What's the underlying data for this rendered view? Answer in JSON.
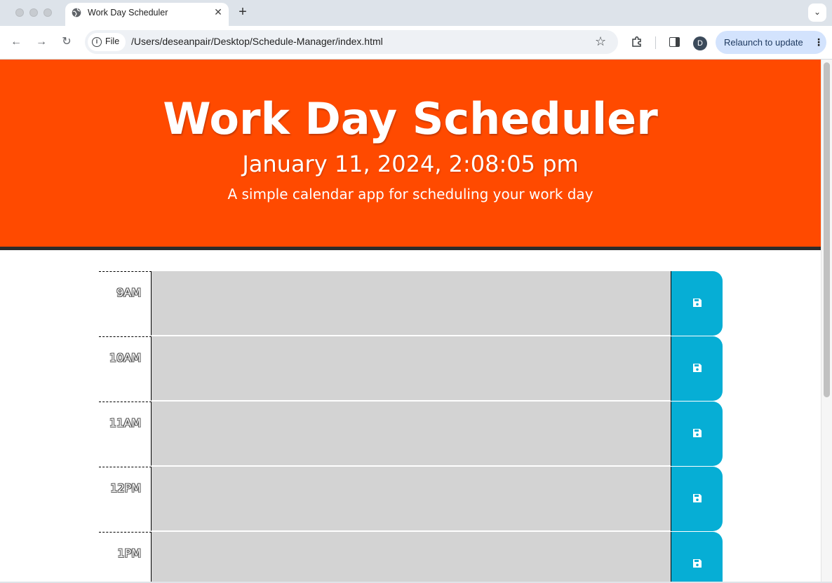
{
  "browser": {
    "tab_title": "Work Day Scheduler",
    "close_glyph": "✕",
    "new_tab_glyph": "+",
    "tab_menu_glyph": "⌄",
    "file_chip_label": "File",
    "url": "/Users/deseanpair/Desktop/Schedule-Manager/index.html",
    "avatar_letter": "D",
    "relaunch_label": "Relaunch to update",
    "kebab_glyph": "⋮",
    "back_glyph": "←",
    "forward_glyph": "→",
    "reload_glyph": "↻",
    "star_glyph": "☆",
    "info_glyph": "i"
  },
  "header": {
    "title": "Work Day Scheduler",
    "datetime": "January 11, 2024, 2:08:05 pm",
    "lead": "A simple calendar app for scheduling your work day"
  },
  "schedule": {
    "rows": [
      {
        "hour": "9AM"
      },
      {
        "hour": "10AM"
      },
      {
        "hour": "11AM"
      },
      {
        "hour": "12PM"
      },
      {
        "hour": "1PM"
      }
    ]
  },
  "colors": {
    "header_bg": "#ff4a00",
    "past_block": "#d3d3d3",
    "save_button": "#06aed5"
  },
  "icons": {
    "save": "floppy-disk-icon",
    "tab": "globe-icon",
    "extensions": "puzzle-icon",
    "side_panel": "side-panel-icon"
  }
}
